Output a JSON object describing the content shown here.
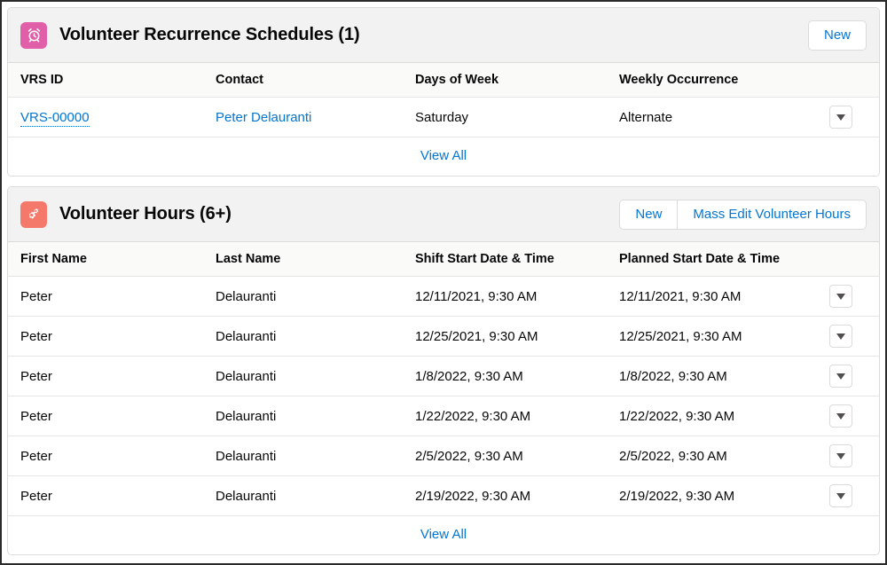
{
  "sections": [
    {
      "id": "volunteer-recurrence-schedules",
      "icon": "alarm-clock-icon",
      "icon_color": "#e05fa8",
      "title": "Volunteer Recurrence Schedules (1)",
      "actions": [
        {
          "label": "New",
          "name": "new-button"
        }
      ],
      "columns": [
        "VRS ID",
        "Contact",
        "Days of Week",
        "Weekly Occurrence"
      ],
      "rows": [
        {
          "vrs_id": "VRS-00000",
          "contact": "Peter Delauranti",
          "days_of_week": "Saturday",
          "weekly_occurrence": "Alternate"
        }
      ],
      "footer_link": "View All"
    },
    {
      "id": "volunteer-hours",
      "icon": "gears-icon",
      "icon_color": "#f4796b",
      "title": "Volunteer Hours (6+)",
      "actions": [
        {
          "label": "New",
          "name": "new-button"
        },
        {
          "label": "Mass Edit Volunteer Hours",
          "name": "mass-edit-volunteer-hours-button"
        }
      ],
      "columns": [
        "First Name",
        "Last Name",
        "Shift Start Date & Time",
        "Planned Start Date & Time"
      ],
      "rows": [
        {
          "first_name": "Peter",
          "last_name": "Delauranti",
          "shift_start": "12/11/2021, 9:30 AM",
          "planned_start": "12/11/2021, 9:30 AM"
        },
        {
          "first_name": "Peter",
          "last_name": "Delauranti",
          "shift_start": "12/25/2021, 9:30 AM",
          "planned_start": "12/25/2021, 9:30 AM"
        },
        {
          "first_name": "Peter",
          "last_name": "Delauranti",
          "shift_start": "1/8/2022, 9:30 AM",
          "planned_start": "1/8/2022, 9:30 AM"
        },
        {
          "first_name": "Peter",
          "last_name": "Delauranti",
          "shift_start": "1/22/2022, 9:30 AM",
          "planned_start": "1/22/2022, 9:30 AM"
        },
        {
          "first_name": "Peter",
          "last_name": "Delauranti",
          "shift_start": "2/5/2022, 9:30 AM",
          "planned_start": "2/5/2022, 9:30 AM"
        },
        {
          "first_name": "Peter",
          "last_name": "Delauranti",
          "shift_start": "2/19/2022, 9:30 AM",
          "planned_start": "2/19/2022, 9:30 AM"
        }
      ],
      "footer_link": "View All"
    }
  ],
  "colors": {
    "link": "#0176d3",
    "header_bg": "#f3f2f2",
    "table_header_bg": "#fafaf9",
    "border": "#dddbda"
  }
}
